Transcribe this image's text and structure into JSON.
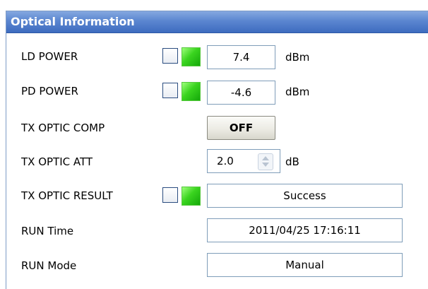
{
  "panel": {
    "title": "Optical Information"
  },
  "rows": {
    "ld_power": {
      "label": "LD POWER",
      "value": "7.4",
      "unit": "dBm",
      "status": "on"
    },
    "pd_power": {
      "label": "PD POWER",
      "value": "-4.6",
      "unit": "dBm",
      "status": "on"
    },
    "tx_optic_comp": {
      "label": "TX OPTIC COMP",
      "button_label": "OFF"
    },
    "tx_optic_att": {
      "label": "TX OPTIC ATT",
      "value": "2.0",
      "unit": "dB"
    },
    "tx_optic_result": {
      "label": "TX OPTIC RESULT",
      "value": "Success",
      "status": "on"
    },
    "run_time": {
      "label": "RUN Time",
      "value": "2011/04/25 17:16:11"
    },
    "run_mode": {
      "label": "RUN Mode",
      "value": "Manual"
    }
  },
  "colors": {
    "title_bar": "#5b86d0",
    "indicator_on": "#3ad41f",
    "field_border": "#7f9db9"
  }
}
